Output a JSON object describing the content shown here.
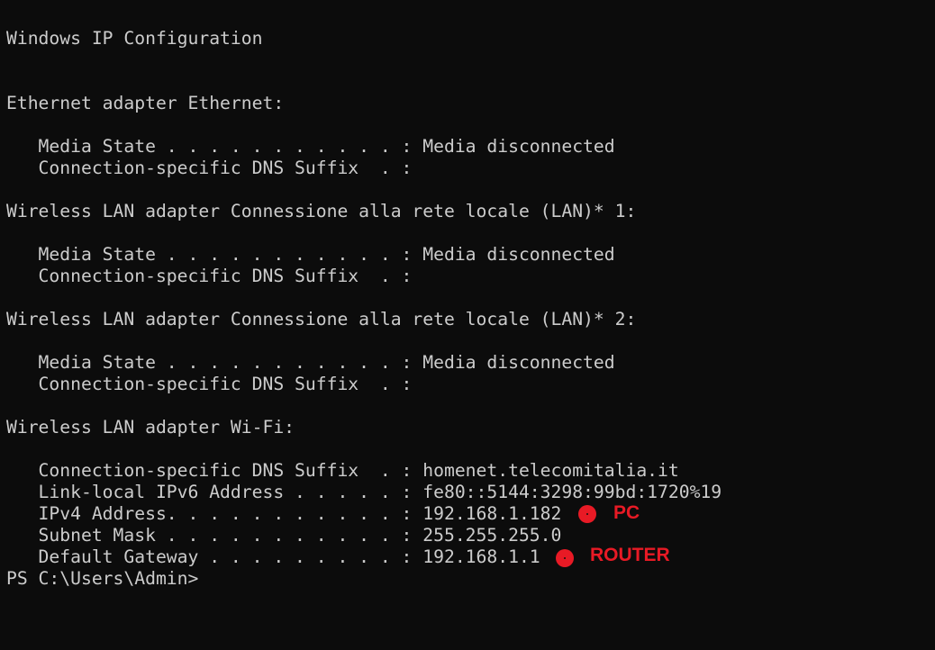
{
  "terminal": {
    "header": "Windows IP Configuration",
    "ethernet": {
      "title": "Ethernet adapter Ethernet:",
      "media_state": "   Media State . . . . . . . . . . . : Media disconnected",
      "dns_suffix": "   Connection-specific DNS Suffix  . :"
    },
    "wlan1": {
      "title": "Wireless LAN adapter Connessione alla rete locale (LAN)* 1:",
      "media_state": "   Media State . . . . . . . . . . . : Media disconnected",
      "dns_suffix": "   Connection-specific DNS Suffix  . :"
    },
    "wlan2": {
      "title": "Wireless LAN adapter Connessione alla rete locale (LAN)* 2:",
      "media_state": "   Media State . . . . . . . . . . . : Media disconnected",
      "dns_suffix": "   Connection-specific DNS Suffix  . :"
    },
    "wifi": {
      "title": "Wireless LAN adapter Wi-Fi:",
      "dns_suffix": "   Connection-specific DNS Suffix  . : homenet.telecomitalia.it",
      "ipv6": "   Link-local IPv6 Address . . . . . : fe80::5144:3298:99bd:1720%19",
      "ipv4": "   IPv4 Address. . . . . . . . . . . : 192.168.1.182",
      "subnet": "   Subnet Mask . . . . . . . . . . . : 255.255.255.0",
      "gateway": "   Default Gateway . . . . . . . . . : 192.168.1.1"
    },
    "prompt": "PS C:\\Users\\Admin>"
  },
  "annotations": {
    "pc_label": "PC",
    "router_label": "ROUTER",
    "color": "#e81a25"
  }
}
